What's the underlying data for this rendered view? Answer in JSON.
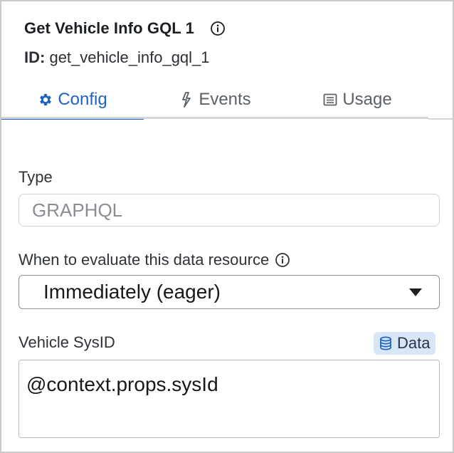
{
  "header": {
    "title": "Get Vehicle Info GQL 1",
    "id_label": "ID:",
    "id_value": "get_vehicle_info_gql_1"
  },
  "tabs": [
    {
      "label": "Config",
      "icon": "gear-icon",
      "active": true
    },
    {
      "label": "Events",
      "icon": "bolt-icon",
      "active": false
    },
    {
      "label": "Usage",
      "icon": "list-icon",
      "active": false
    }
  ],
  "fields": {
    "type": {
      "label": "Type",
      "value": "GRAPHQL"
    },
    "evaluate": {
      "label": "When to evaluate this data resource",
      "selected": "Immediately (eager)"
    },
    "sysid": {
      "label": "Vehicle SysID",
      "badge": "Data",
      "value": "@context.props.sysId"
    }
  },
  "colors": {
    "accent": "#1d63c5",
    "badge_bg": "#d8e7f7",
    "border": "#c9c9c9"
  }
}
